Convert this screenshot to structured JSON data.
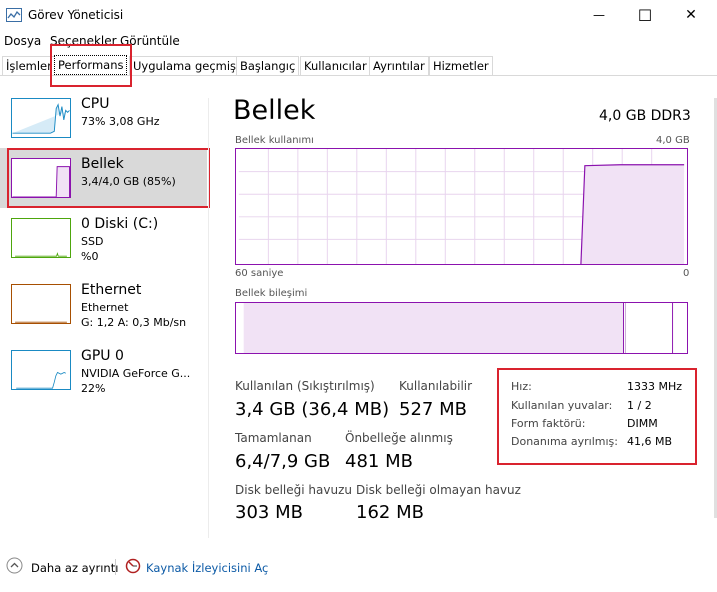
{
  "window": {
    "title": "Görev Yöneticisi",
    "minimize": "—",
    "maximize": "☐",
    "close": "✕"
  },
  "menu": [
    "Dosya",
    "Seçenekler",
    "Görüntüle"
  ],
  "tabs": [
    "İşlemler",
    "Performans",
    "Uygulama geçmişi",
    "Başlangıç",
    "Kullanıcılar",
    "Ayrıntılar",
    "Hizmetler"
  ],
  "active_tab": "Performans",
  "sidebar": [
    {
      "name": "CPU",
      "sub1": "73% 3,08 GHz",
      "sub2": "",
      "color": "#1a8ac3"
    },
    {
      "name": "Bellek",
      "sub1": "3,4/4,0 GB (85%)",
      "sub2": "",
      "color": "#8b12ae"
    },
    {
      "name": "0 Diski (C:)",
      "sub1": "SSD",
      "sub2": "%0",
      "color": "#4da60c"
    },
    {
      "name": "Ethernet",
      "sub1": "Ethernet",
      "sub2": "G: 1,2 A: 0,3 Mb/sn",
      "color": "#a74f01"
    },
    {
      "name": "GPU 0",
      "sub1": "NVIDIA GeForce G...",
      "sub2": "22%",
      "color": "#1a8ac3"
    }
  ],
  "main": {
    "title": "Bellek",
    "spec": "4,0 GB DDR3",
    "usage_chart": {
      "label": "Bellek kullanımı",
      "max_label": "4,0 GB",
      "time_label": "60 saniye",
      "min_label": "0"
    },
    "composition_label": "Bellek bileşimi",
    "stats": {
      "in_use_label": "Kullanılan (Sıkıştırılmış)",
      "in_use_value": "3,4 GB (36,4 MB)",
      "available_label": "Kullanılabilir",
      "available_value": "527 MB",
      "committed_label": "Tamamlanan",
      "committed_value": "6,4/7,9 GB",
      "cached_label": "Önbelleğe alınmış",
      "cached_value": "481 MB",
      "paged_label": "Disk belleği havuzu",
      "paged_value": "303 MB",
      "nonpaged_label": "Disk belleği olmayan havuz",
      "nonpaged_value": "162 MB"
    },
    "info": [
      {
        "label": "Hız:",
        "value": "1333 MHz"
      },
      {
        "label": "Kullanılan yuvalar:",
        "value": "1 / 2"
      },
      {
        "label": "Form faktörü:",
        "value": "DIMM"
      },
      {
        "label": "Donanıma ayrılmış:",
        "value": "41,6 MB"
      }
    ]
  },
  "footer": {
    "less_details": "Daha az ayrıntı",
    "resource_monitor": "Kaynak İzleyicisini Aç"
  },
  "colors": {
    "memory": "#8b12ae",
    "highlight": "#d9232e",
    "link": "#0c5aa6"
  }
}
